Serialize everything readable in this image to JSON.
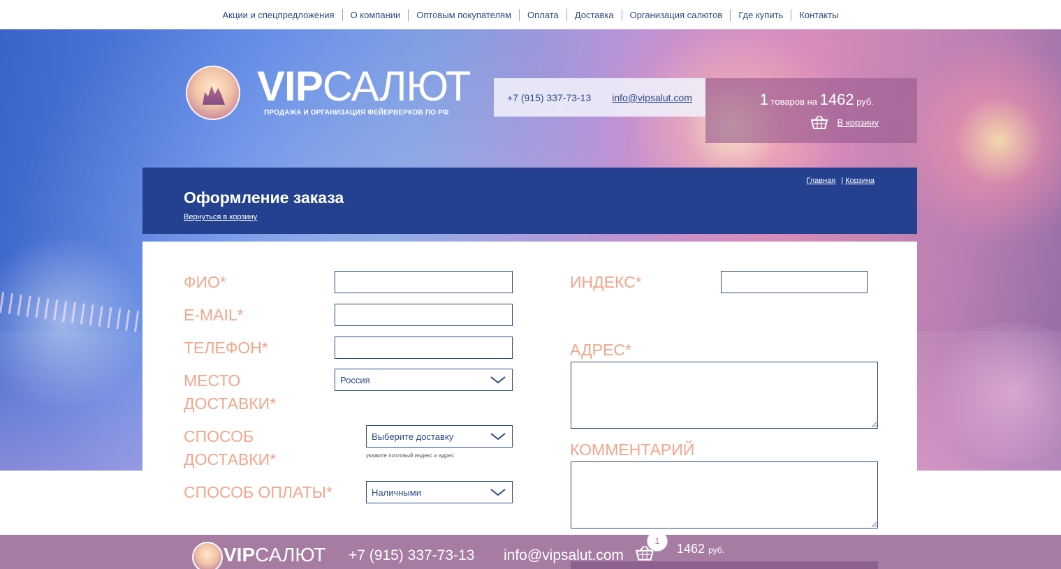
{
  "topnav": {
    "items": [
      "Акции и спецпредложения",
      "О компании",
      "Оптовым покупателям",
      "Оплата",
      "Доставка",
      "Организация салютов",
      "Где купить",
      "Контакты"
    ]
  },
  "logo": {
    "word_bold": "VIP",
    "word_light": "САЛЮТ",
    "tagline": "ПРОДАЖА И ОРГАНИЗАЦИЯ ФЕЙЕРВЕРКОВ ПО РФ"
  },
  "contact": {
    "phone": "+7 (915) 337-73-13",
    "email": "info@vipsalut.com"
  },
  "cart": {
    "count": "1",
    "count_text": "товаров на",
    "sum": "1462",
    "currency": "руб.",
    "link": "В корзину"
  },
  "titlebar": {
    "title": "Оформление заказа",
    "back_link": "Вернуться в корзину",
    "crumb_home": "Главная",
    "crumb_sep": "|",
    "crumb_cart": "Корзина"
  },
  "form": {
    "fio_label": "ФИО*",
    "email_label": "E-MAIL*",
    "phone_label": "ТЕЛЕФОН*",
    "place_label_1": "МЕСТО",
    "place_label_2": "ДОСТАВКИ*",
    "place_value": "Россия",
    "method_label_1": "СПОСОБ",
    "method_label_2": "ДОСТАВКИ*",
    "method_value": "Выберите доставку",
    "method_hint": "укажите почтовый индекс и адрес",
    "payment_label": "СПОСОБ ОПЛАТЫ*",
    "payment_value": "Наличными",
    "index_label": "ИНДЕКС*",
    "address_label": "АДРЕС*",
    "comment_label": "КОММЕНТАРИЙ"
  },
  "footer": {
    "word_bold": "VIP",
    "word_light": "САЛЮТ",
    "phone": "+7 (915) 337-73-13",
    "email": "info@vipsalut.com",
    "cart_count": "1",
    "sum": "1462",
    "currency": "руб."
  },
  "colors": {
    "nav_text": "#2a4a85",
    "title_bar": "#23418f",
    "label_salmon": "#f2a68c",
    "footer_bg": "#a67ca3"
  }
}
